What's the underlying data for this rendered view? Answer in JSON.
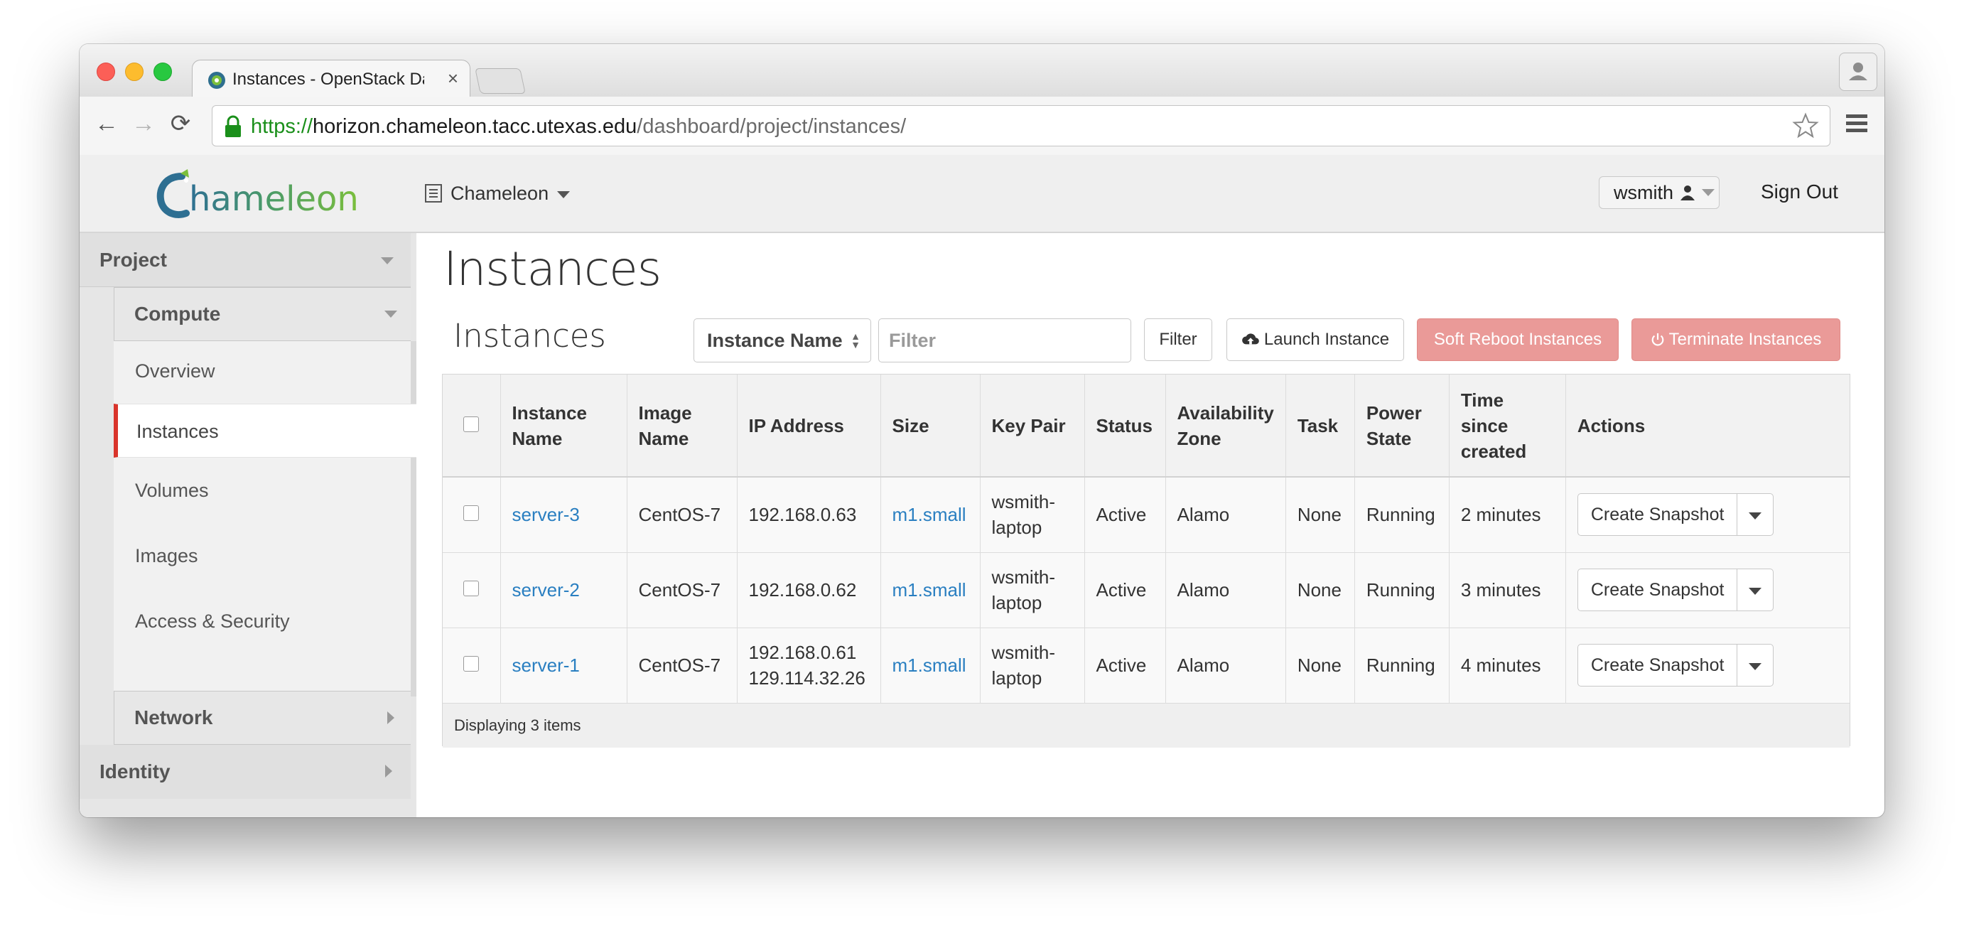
{
  "browser": {
    "tab_title": "Instances - OpenStack Das",
    "tab_close": "×",
    "url_scheme": "https://",
    "url_host": "horizon.chameleon.tacc.utexas.edu",
    "url_path": "/dashboard/project/instances/",
    "back_glyph": "←",
    "forward_glyph": "→",
    "reload_glyph": "⟳"
  },
  "header": {
    "project_name": "Chameleon",
    "user_name": "wsmith",
    "sign_out": "Sign Out"
  },
  "sidebar": {
    "project": "Project",
    "compute": "Compute",
    "items": [
      "Overview",
      "Instances",
      "Volumes",
      "Images",
      "Access & Security"
    ],
    "network": "Network",
    "identity": "Identity"
  },
  "main": {
    "page_title": "Instances",
    "section_title": "Instances",
    "filter_field": "Instance Name",
    "filter_placeholder": "Filter",
    "filter_button": "Filter",
    "launch_button": "Launch Instance",
    "soft_reboot_button": "Soft Reboot Instances",
    "terminate_button": "Terminate Instances"
  },
  "table": {
    "headers": {
      "name": "Instance Name",
      "image": "Image Name",
      "ip": "IP Address",
      "size": "Size",
      "keypair": "Key Pair",
      "status": "Status",
      "zone": "Availability Zone",
      "task": "Task",
      "power": "Power State",
      "created": "Time since created",
      "actions": "Actions"
    },
    "rows": [
      {
        "name": "server-3",
        "image": "CentOS-7",
        "ip": "192.168.0.63",
        "ip2": "",
        "size": "m1.small",
        "keypair": "wsmith-laptop",
        "status": "Active",
        "zone": "Alamo",
        "task": "None",
        "power": "Running",
        "created": "2 minutes",
        "action": "Create Snapshot"
      },
      {
        "name": "server-2",
        "image": "CentOS-7",
        "ip": "192.168.0.62",
        "ip2": "",
        "size": "m1.small",
        "keypair": "wsmith-laptop",
        "status": "Active",
        "zone": "Alamo",
        "task": "None",
        "power": "Running",
        "created": "3 minutes",
        "action": "Create Snapshot"
      },
      {
        "name": "server-1",
        "image": "CentOS-7",
        "ip": "192.168.0.61",
        "ip2": "129.114.32.26",
        "size": "m1.small",
        "keypair": "wsmith-laptop",
        "status": "Active",
        "zone": "Alamo",
        "task": "None",
        "power": "Running",
        "created": "4 minutes",
        "action": "Create Snapshot"
      }
    ],
    "footer": "Displaying 3 items"
  },
  "colors": {
    "accent_red": "#d9342b",
    "danger_button": "#ea9a98",
    "link_blue": "#2a7fc1",
    "secure_green": "#1a8f1a"
  },
  "icons": [
    "chameleon-favicon",
    "lock-icon",
    "star-icon",
    "menu-icon",
    "profile-icon",
    "project-list-icon",
    "user-icon",
    "cloud-upload-icon",
    "power-icon"
  ]
}
